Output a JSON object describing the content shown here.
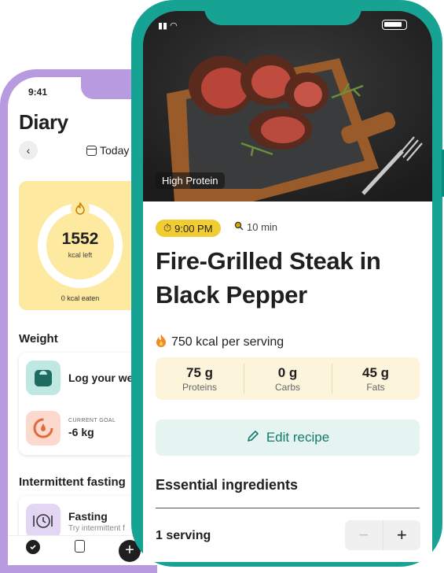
{
  "back_phone": {
    "time": "9:41",
    "title": "Diary",
    "date_label": "Today",
    "calories": {
      "value": "1552",
      "unit": "kcal left",
      "eaten": "0 kcal eaten"
    },
    "weight": {
      "section_title": "Weight",
      "log_label": "Log your weig",
      "goal_caption": "CURRENT GOAL",
      "goal_value": "-6 kg"
    },
    "fasting": {
      "section_title": "Intermittent fasting",
      "label": "Fasting",
      "sublabel": "Try intermittent f"
    }
  },
  "front_phone": {
    "hero_tag": "High Protein",
    "time_pill": "9:00 PM",
    "duration": "10 min",
    "title": "Fire-Grilled Steak in Black Pepper",
    "kcal": "750 kcal per serving",
    "macros": [
      {
        "value": "75 g",
        "label": "Proteins"
      },
      {
        "value": "0 g",
        "label": "Carbs"
      },
      {
        "value": "45 g",
        "label": "Fats"
      }
    ],
    "edit_label": "Edit recipe",
    "ingredients_title": "Essential ingredients",
    "serving_label": "1 serving",
    "stepper": {
      "minus": "−",
      "plus": "+"
    }
  },
  "colors": {
    "teal_frame": "#16a394",
    "purple_frame": "#b79ae0",
    "yellow_pill": "#f2cc33",
    "macro_bg": "#fdf4dc",
    "edit_bg": "#e6f4f1",
    "edit_text": "#127a6d"
  }
}
